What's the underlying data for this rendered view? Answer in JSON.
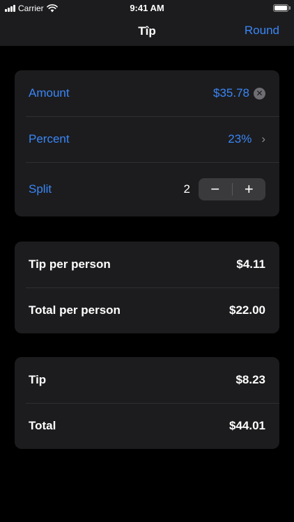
{
  "status_bar": {
    "carrier": "Carrier",
    "time": "9:41 AM"
  },
  "nav": {
    "title": "Tîp",
    "action_label": "Round"
  },
  "inputs": {
    "amount_label": "Amount",
    "amount_value": "$35.78",
    "percent_label": "Percent",
    "percent_value": "23%",
    "split_label": "Split",
    "split_value": "2",
    "minus_symbol": "−",
    "plus_symbol": "+"
  },
  "per_person": {
    "tip_label": "Tip per person",
    "tip_value": "$4.11",
    "total_label": "Total per person",
    "total_value": "$22.00"
  },
  "totals": {
    "tip_label": "Tip",
    "tip_value": "$8.23",
    "total_label": "Total",
    "total_value": "$44.01"
  },
  "colors": {
    "accent": "#3a86f7",
    "card": "#1c1c1e",
    "background": "#000000"
  },
  "icons": {
    "clear": "clear-circle-icon",
    "chevron": "chevron-right-icon",
    "signal": "signal-icon",
    "wifi": "wifi-icon",
    "battery": "battery-icon"
  }
}
